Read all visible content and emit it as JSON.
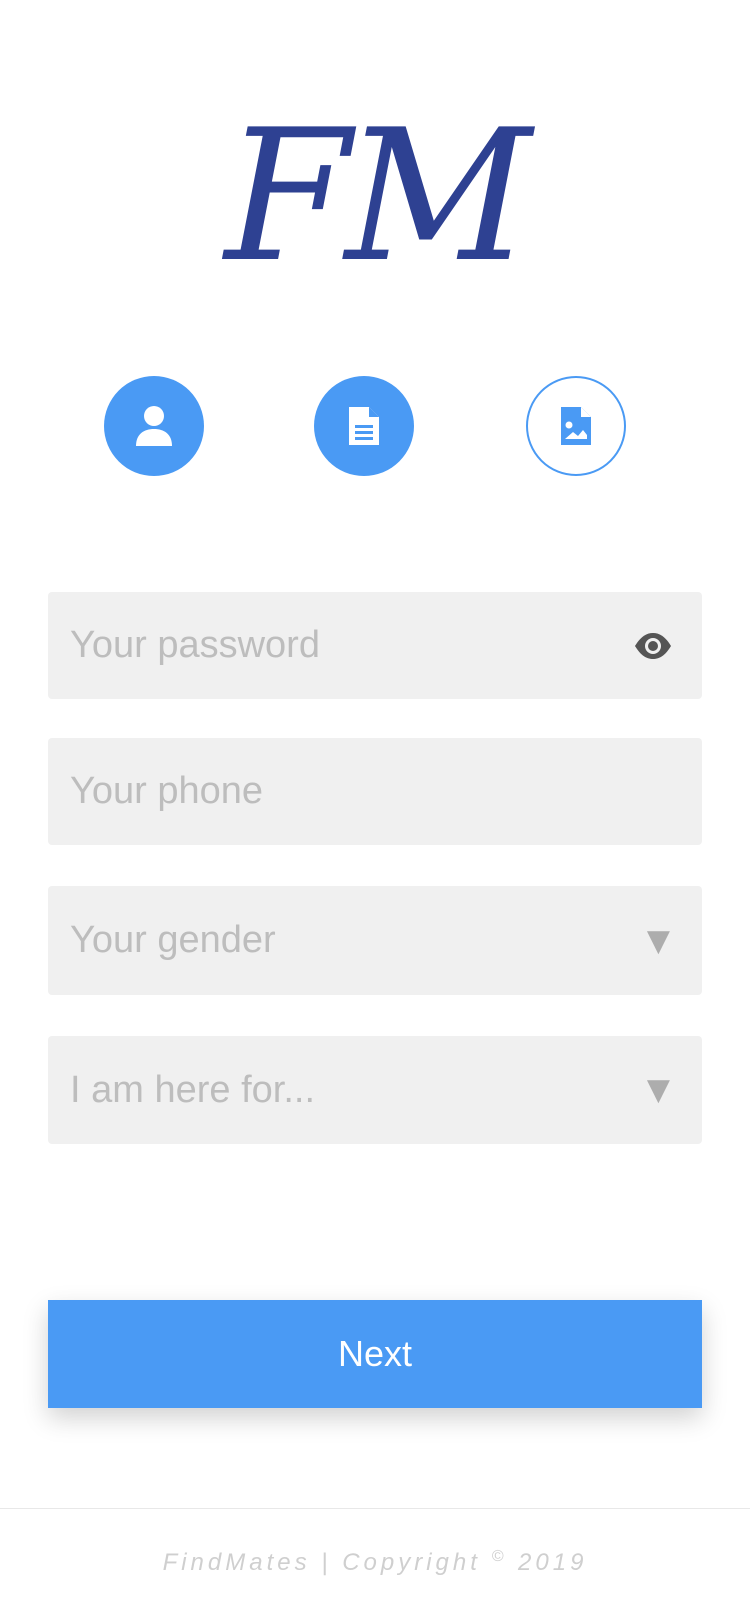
{
  "logo": {
    "text": "FM",
    "color": "#2e4192"
  },
  "steps": [
    {
      "icon": "user-icon",
      "state": "completed"
    },
    {
      "icon": "document-icon",
      "state": "completed"
    },
    {
      "icon": "image-document-icon",
      "state": "current"
    }
  ],
  "form": {
    "password": {
      "placeholder": "Your password",
      "value": ""
    },
    "phone": {
      "placeholder": "Your phone",
      "value": ""
    },
    "gender": {
      "placeholder": "Your gender"
    },
    "purpose": {
      "placeholder": "I am here for..."
    }
  },
  "next_button": {
    "label": "Next"
  },
  "footer": {
    "brand": "FindMates",
    "separator": "|",
    "copyright": "Copyright",
    "symbol": "©",
    "year": "2019"
  },
  "colors": {
    "accent": "#4a9af4",
    "logo": "#2e4192",
    "field_bg": "#f0f0f0",
    "placeholder": "#bdbdbd"
  }
}
